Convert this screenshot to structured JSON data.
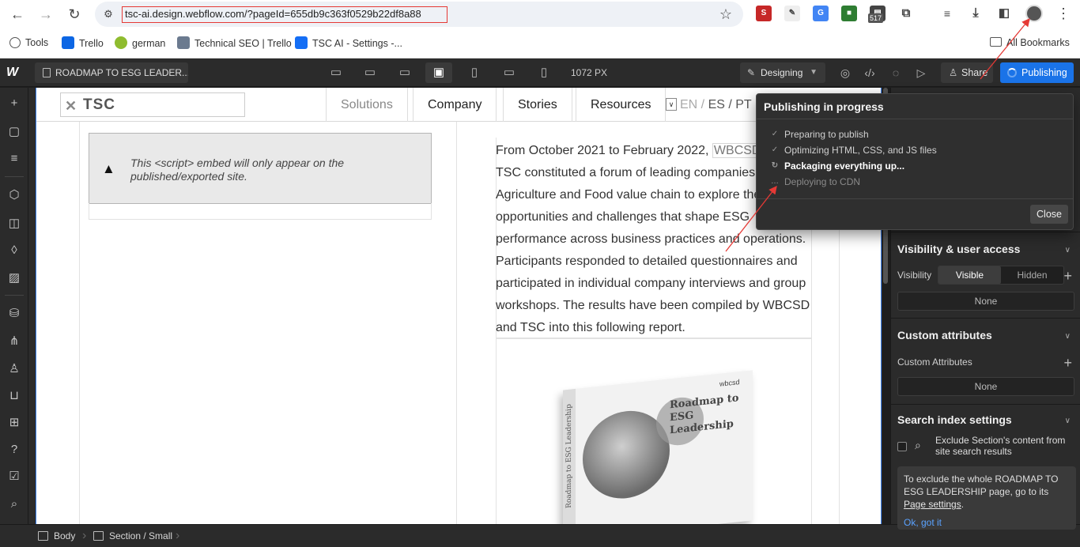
{
  "browser": {
    "url": "tsc-ai.design.webflow.com/?pageId=655db9c363f0529b22df8a88",
    "extension_badge": "517",
    "bookmarks": [
      {
        "label": "Tools",
        "color": "#555555"
      },
      {
        "label": "Trello",
        "color": "#0c66e4"
      },
      {
        "label": "german",
        "color": "#8fbc2f"
      },
      {
        "label": "Technical SEO | Trello",
        "color": "#6b7a8f"
      },
      {
        "label": "TSC AI - Settings -...",
        "color": "#146ef5"
      }
    ],
    "all_bookmarks": "All Bookmarks"
  },
  "webflow": {
    "page_name": "ROADMAP TO ESG LEADER...",
    "width_label": "1072 PX",
    "mode": "Designing",
    "share_label": "Share",
    "publish_label": "Publishing"
  },
  "site": {
    "logo": "TSC",
    "nav": [
      "Solutions",
      "Company",
      "Stories",
      "Resources"
    ],
    "lang_en": "EN /",
    "lang_rest": "ES / PT",
    "embed_notice": "This <script> embed will only appear on the published/exported site.",
    "body_before": "From October 2021 to February 2022, ",
    "body_highlight": "WBCSD",
    "body_after": " and TSC constituted a forum of leading companies in the Agriculture and Food value chain to explore the opportunities and challenges that shape ESG performance across business practices and operations. Participants responded to detailed questionnaires and participated in individual company interviews and group workshops. The results have been compiled by WBCSD and TSC into this following report.",
    "book_title": "Roadmap to ESG Leadership",
    "book_brand": "wbcsd",
    "book_spine": "Roadmap to ESG Leadership"
  },
  "breadcrumb": [
    "Body",
    "Section / Small"
  ],
  "publishing": {
    "title": "Publishing in progress",
    "steps": [
      {
        "label": "Preparing to publish",
        "state": "done"
      },
      {
        "label": "Optimizing HTML, CSS, and JS files",
        "state": "done"
      },
      {
        "label": "Packaging everything up...",
        "state": "active"
      },
      {
        "label": "Deploying to CDN",
        "state": "pending"
      }
    ],
    "close_label": "Close"
  },
  "right_panel": {
    "visibility_title": "Visibility & user access",
    "visibility_label": "Visibility",
    "visible": "Visible",
    "hidden": "Hidden",
    "visibility_none": "None",
    "custom_attr_title": "Custom attributes",
    "custom_attr_label": "Custom Attributes",
    "custom_attr_none": "None",
    "search_title": "Search index settings",
    "exclude_label": "Exclude Section's content from site search results",
    "tip_before": "To exclude the whole ROADMAP TO ESG LEADERSHIP page, go to its ",
    "tip_link": "Page settings",
    "tip_after": ".",
    "tip_ok": "Ok, got it"
  },
  "colors": {
    "accent": "#1a73e8",
    "annotation": "#e53935"
  }
}
